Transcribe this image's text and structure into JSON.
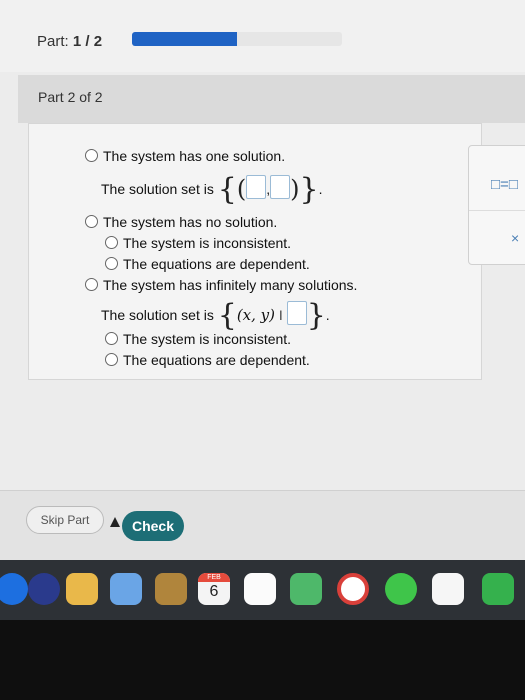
{
  "header": {
    "part_label": "Part:",
    "part_progress": "1 / 2",
    "progress_fraction": 0.5
  },
  "section": {
    "title": "Part 2 of 2"
  },
  "question": {
    "option_one": "The system has one solution.",
    "solution_set_prefix": "The solution set is",
    "option_none": "The system has no solution.",
    "sub_inconsistent": "The system is inconsistent.",
    "sub_dependent": "The equations are dependent.",
    "option_infinite": "The system has infinitely many solutions.",
    "solution_set_prefix_2": "The solution set is",
    "set_builder_vars": "(x, y)",
    "set_builder_bar": "I",
    "sub_inconsistent_2": "The system is inconsistent.",
    "sub_dependent_2": "The equations are dependent."
  },
  "side_panel": {
    "equals_symbol": "□=□",
    "close_symbol": "×"
  },
  "actions": {
    "skip_label": "Skip Part",
    "check_label": "Check"
  },
  "dock": {
    "calendar_month": "FEB",
    "calendar_day": "6"
  },
  "colors": {
    "progress": "#1f63c4",
    "check_button": "#1d6e76",
    "input_border": "#9bbbd6"
  }
}
